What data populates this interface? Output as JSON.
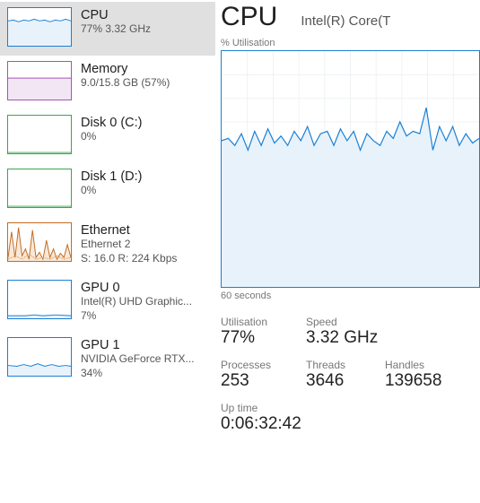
{
  "sidebar": {
    "items": [
      {
        "title": "CPU",
        "sub1": "77% 3.32 GHz",
        "sub2": "",
        "color": "#1a7fd4",
        "kind": "cpu"
      },
      {
        "title": "Memory",
        "sub1": "9.0/15.8 GB (57%)",
        "sub2": "",
        "color": "#a455b2",
        "kind": "mem"
      },
      {
        "title": "Disk 0 (C:)",
        "sub1": "0%",
        "sub2": "",
        "color": "#3aa64a",
        "kind": "disk"
      },
      {
        "title": "Disk 1 (D:)",
        "sub1": "0%",
        "sub2": "",
        "color": "#3aa64a",
        "kind": "disk"
      },
      {
        "title": "Ethernet",
        "sub1": "Ethernet 2",
        "sub2": "S: 16.0 R: 224 Kbps",
        "color": "#c46a1e",
        "kind": "net"
      },
      {
        "title": "GPU 0",
        "sub1": "Intel(R) UHD Graphic...",
        "sub2": "7%",
        "color": "#1a7fd4",
        "kind": "gpu0"
      },
      {
        "title": "GPU 1",
        "sub1": "NVIDIA GeForce RTX...",
        "sub2": "34%",
        "color": "#1a7fd4",
        "kind": "gpu1"
      }
    ]
  },
  "main": {
    "title": "CPU",
    "subtitle": "Intel(R) Core(T",
    "chart_top_label": "% Utilisation",
    "chart_bottom_label": "60 seconds",
    "stats": {
      "row1": [
        {
          "label": "Utilisation",
          "value": "77%"
        },
        {
          "label": "Speed",
          "value": "3.32 GHz"
        }
      ],
      "row2": [
        {
          "label": "Processes",
          "value": "253"
        },
        {
          "label": "Threads",
          "value": "3646"
        },
        {
          "label": "Handles",
          "value": "139658"
        }
      ],
      "uptime_label": "Up time",
      "uptime_value": "0:06:32:42"
    }
  },
  "chart_data": {
    "type": "line",
    "title": "CPU % Utilisation",
    "xlabel": "60 seconds",
    "ylabel": "% Utilisation",
    "ylim": [
      0,
      100
    ],
    "x_seconds": 60,
    "values": [
      62,
      63,
      60,
      65,
      58,
      66,
      60,
      67,
      61,
      64,
      60,
      66,
      62,
      68,
      60,
      65,
      66,
      60,
      67,
      62,
      66,
      58,
      65,
      62,
      60,
      66,
      63,
      70,
      64,
      66,
      65,
      76,
      58,
      68,
      62,
      68,
      60,
      65,
      61,
      63
    ]
  }
}
